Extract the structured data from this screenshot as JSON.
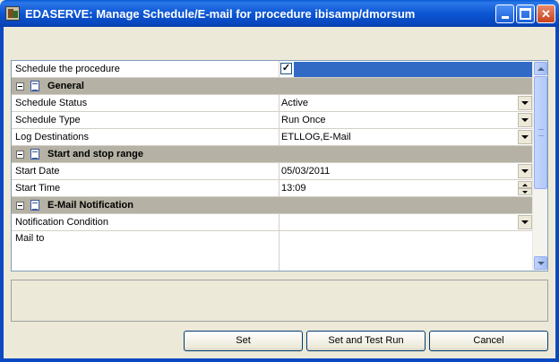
{
  "window": {
    "title": "EDASERVE: Manage Schedule/E-mail for procedure ibisamp/dmorsum"
  },
  "grid": {
    "schedule_row": {
      "label": "Schedule the procedure",
      "checked": "✓"
    },
    "categories": {
      "general": "General",
      "range": "Start and stop range",
      "email": "E-Mail Notification"
    },
    "rows": {
      "status": {
        "label": "Schedule Status",
        "value": "Active"
      },
      "type": {
        "label": "Schedule Type",
        "value": "Run Once"
      },
      "log": {
        "label": "Log Destinations",
        "value": "ETLLOG,E-Mail"
      },
      "start_date": {
        "label": "Start Date",
        "value": "05/03/2011"
      },
      "start_time": {
        "label": "Start Time",
        "value": "13:09"
      },
      "notify": {
        "label": "Notification Condition",
        "value": ""
      },
      "mail_to": {
        "label": "Mail to",
        "value": ""
      }
    }
  },
  "buttons": {
    "set": "Set",
    "set_test": "Set and Test Run",
    "cancel": "Cancel"
  },
  "colors": {
    "titlebar": "#0a5ad6",
    "selection": "#316ac5",
    "category": "#b5b1a4"
  }
}
